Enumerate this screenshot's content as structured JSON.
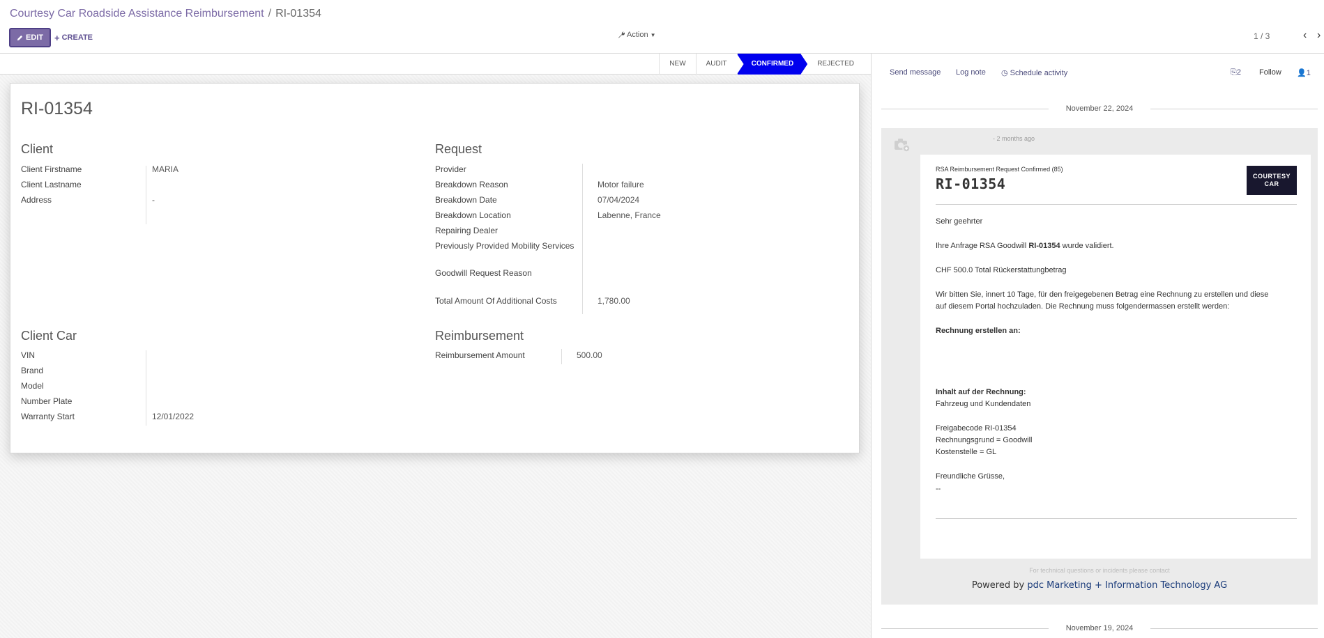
{
  "breadcrumb": {
    "parent": "Courtesy Car Roadside Assistance Reimbursement",
    "separator": "/",
    "current": "RI-01354"
  },
  "toolbar": {
    "edit_label": "EDIT",
    "create_label": "CREATE",
    "action_label": "Action"
  },
  "pager": {
    "value": "1 / 3"
  },
  "statusbar": {
    "steps": [
      "NEW",
      "AUDIT",
      "CONFIRMED",
      "REJECTED"
    ],
    "active": "CONFIRMED",
    "active_color": "#0000ee"
  },
  "record": {
    "name": "RI-01354",
    "client": {
      "title": "Client",
      "fields": [
        {
          "label": "Client Firstname",
          "value": "MARIA"
        },
        {
          "label": "Client Lastname",
          "value": ""
        },
        {
          "label": "Address",
          "value": "-"
        }
      ]
    },
    "request": {
      "title": "Request",
      "fields": [
        {
          "label": "Provider",
          "value": ""
        },
        {
          "label": "Breakdown Reason",
          "value": "Motor failure"
        },
        {
          "label": "Breakdown Date",
          "value": "07/04/2024"
        },
        {
          "label": "Breakdown Location",
          "value": "Labenne, France"
        },
        {
          "label": "Repairing Dealer",
          "value": ""
        },
        {
          "label": "Previously Provided Mobility Services",
          "value": ""
        },
        {
          "label": "Goodwill Request Reason",
          "value": ""
        },
        {
          "label": "Total Amount Of Additional Costs",
          "value": "1,780.00"
        }
      ]
    },
    "client_car": {
      "title": "Client Car",
      "fields": [
        {
          "label": "VIN",
          "value": ""
        },
        {
          "label": "Brand",
          "value": ""
        },
        {
          "label": "Model",
          "value": ""
        },
        {
          "label": "Number Plate",
          "value": ""
        },
        {
          "label": "Warranty Start",
          "value": "12/01/2022"
        }
      ]
    },
    "reimbursement": {
      "title": "Reimbursement",
      "fields": [
        {
          "label": "Reimbursement Amount",
          "value": "500.00"
        }
      ]
    }
  },
  "chatter": {
    "send_message": "Send message",
    "log_note": "Log note",
    "schedule_activity": "Schedule activity",
    "attachments_count": "2",
    "follow": "Follow",
    "followers_count": "1",
    "date_1": "November 22, 2024",
    "date_2": "November 19, 2024",
    "message": {
      "time": "- 2 months ago",
      "subtitle": "RSA Reimbursement Request Confirmed (85)",
      "heading": "RI-01354",
      "logo_line1": "COURTESY",
      "logo_line2": "CAR",
      "greeting": "Sehr geehrter",
      "line_request_prefix": "Ihre Anfrage RSA Goodwill",
      "line_request_ref": "RI-01354",
      "line_request_suffix": "wurde validiert.",
      "line_amount": "CHF 500.0 Total Rückerstattungbetrag",
      "line_instruction_1": "Wir bitten Sie, innert 10 Tage, für den freigegebenen Betrag eine Rechnung zu erstellen und diese",
      "line_instruction_2": "auf diesem Portal hochzuladen. Die Rechnung muss folgendermassen erstellt werden:",
      "invoice_to": "Rechnung erstellen an:",
      "invoice_content": "Inhalt auf der Rechnung:",
      "vehicle_data": "Fahrzeug und Kundendaten",
      "release_code": "Freigabecode RI-01354",
      "invoice_reason": "Rechnungsgrund = Goodwill",
      "cost_center": "Kostenstelle = GL",
      "regards": "Freundliche Grüsse,",
      "dash": "--",
      "footer_small": "For technical questions or incidents please contact",
      "powered_prefix": "Powered by",
      "powered_company": "pdc Marketing + Information Technology AG"
    }
  }
}
